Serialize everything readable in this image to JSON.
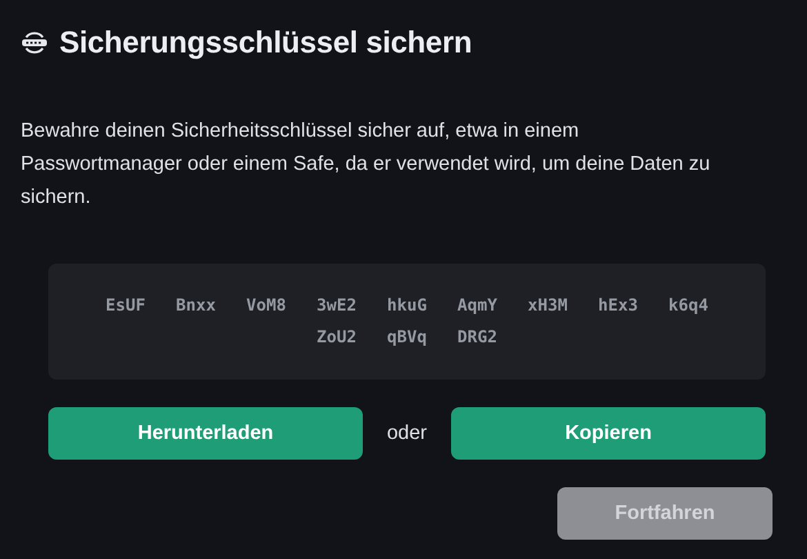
{
  "title": "Sicherungsschlüssel sichern",
  "description": "Bewahre deinen Sicherheitsschlüssel sicher auf, etwa in einem Passwortmanager oder einem Safe, da er verwendet wird, um deine Daten zu sichern.",
  "key_groups": [
    "EsUF",
    "Bnxx",
    "VoM8",
    "3wE2",
    "hkuG",
    "AqmY",
    "xH3M",
    "hEx3",
    "k6q4",
    "ZoU2",
    "qBVq",
    "DRG2"
  ],
  "actions": [
    {
      "label": "Herunterladen",
      "kind": "download"
    },
    {
      "label": "oder",
      "kind": "separator"
    },
    {
      "label": "Kopieren",
      "kind": "copy"
    }
  ],
  "continue_button": {
    "label": "Fortfahren",
    "disabled": true
  }
}
